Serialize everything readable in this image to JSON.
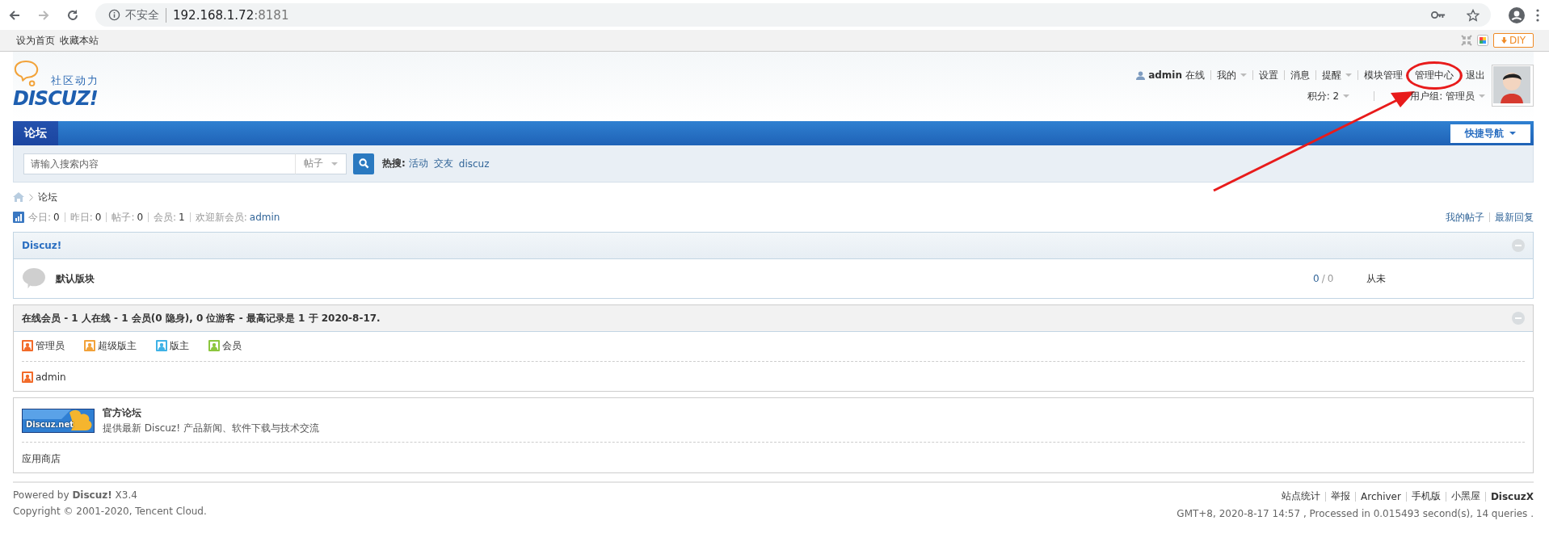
{
  "browser": {
    "security_label": "不安全",
    "host": "192.168.1.72",
    "port": ":8181"
  },
  "bookmarks_bar": {
    "links": [
      "设为首页",
      "收藏本站"
    ],
    "diy_button": "DIY"
  },
  "header": {
    "logo_tagline": "社区动力",
    "logo_text": "DISCUZ!",
    "username": "admin",
    "status": "在线",
    "user_menu": [
      {
        "label": "我的",
        "dropdown": true,
        "highlighted": false
      },
      {
        "label": "设置",
        "dropdown": false,
        "highlighted": false
      },
      {
        "label": "消息",
        "dropdown": false,
        "highlighted": false
      },
      {
        "label": "提醒",
        "dropdown": true,
        "highlighted": false
      },
      {
        "label": "模块管理",
        "dropdown": false,
        "highlighted": false
      },
      {
        "label": "管理中心",
        "dropdown": false,
        "highlighted": true
      },
      {
        "label": "退出",
        "dropdown": false,
        "highlighted": false
      }
    ],
    "credits": "积分: 2",
    "user_group": "用户组: 管理员"
  },
  "nav": {
    "tabs": [
      {
        "label": "论坛",
        "selected": true
      }
    ],
    "quick_nav": "快捷导航"
  },
  "search": {
    "placeholder": "请输入搜索内容",
    "scope": "帖子",
    "hot_label": "热搜:",
    "hot_terms": [
      "活动",
      "交友",
      "discuz"
    ]
  },
  "breadcrumb": [
    "论坛"
  ],
  "stats": {
    "items": [
      {
        "label": "今日:",
        "value": "0"
      },
      {
        "label": "昨日:",
        "value": "0"
      },
      {
        "label": "帖子:",
        "value": "0"
      },
      {
        "label": "会员:",
        "value": "1"
      }
    ],
    "welcome_label": "欢迎新会员:",
    "newest_member": "admin",
    "links": [
      "我的帖子",
      "最新回复"
    ]
  },
  "category": {
    "title": "Discuz!",
    "forums": [
      {
        "name": "默认版块",
        "threads": "0",
        "separator": "/",
        "posts": "0",
        "last_post": "从未"
      }
    ]
  },
  "online": {
    "title": "在线会员 - 1 人在线 - 1 会员(0 隐身), 0 位游客 - 最高记录是 1 于 2020-8-17.",
    "legend": [
      {
        "label": "管理员",
        "color": "#f26b2a"
      },
      {
        "label": "超级版主",
        "color": "#f2a23a"
      },
      {
        "label": "版主",
        "color": "#3fb2e6"
      },
      {
        "label": "会员",
        "color": "#8cc63e"
      }
    ],
    "members": [
      {
        "name": "admin",
        "color": "#f26b2a"
      }
    ]
  },
  "links_box": {
    "featured": [
      {
        "banner_text": "Discuz.net",
        "title": "官方论坛",
        "description": "提供最新 Discuz! 产品新闻、软件下载与技术交流"
      }
    ],
    "text_links": [
      "应用商店"
    ]
  },
  "footer": {
    "powered": "Powered by **Discuz!** X3.4",
    "copyright": "Copyright © 2001-2020, Tencent Cloud.",
    "links": [
      "站点统计",
      "举报",
      "Archiver",
      "手机版",
      "小黑屋"
    ],
    "brand_link": "DiscuzX",
    "timing": "GMT+8, 2020-8-17 14:57 , Processed in 0.015493 second(s), 14 queries ."
  }
}
